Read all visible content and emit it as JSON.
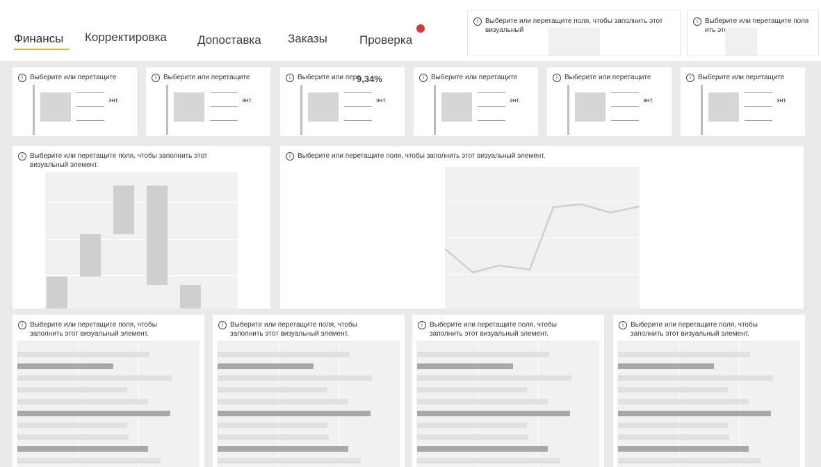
{
  "tabs": [
    "Финансы",
    "Корректировка",
    "Допоставка",
    "Заказы",
    "Проверка"
  ],
  "active_tab": 0,
  "colors": {
    "accent": "#e8b61b",
    "alert_dot": "#d33b35",
    "placeholder": "#d6d6d6",
    "card": "#ffffff"
  },
  "top_right_cards": [
    {
      "info_text": "Выберите или перетащите поля, чтобы заполнить этот визуальный",
      "icon": "info-icon"
    },
    {
      "info_text": "Выберите или перетащите поля ить этот визу т.",
      "icon": "info-icon"
    }
  ],
  "kpi_cards": [
    {
      "info_text": "Выберите или перетащите",
      "tail": "энт."
    },
    {
      "info_text": "Выберите или перетащите",
      "tail": "энт."
    },
    {
      "info_text": "Выберите или пере",
      "value": "9,34%",
      "tail": "энт."
    },
    {
      "info_text": "Выберите или перетащите",
      "tail": "энт."
    },
    {
      "info_text": "Выберите или перетащите",
      "tail": "энт."
    },
    {
      "info_text": "Выберите или перетащите",
      "tail": "энт."
    }
  ],
  "waterfall_card": {
    "info_text": "Выберите или перетащите поля, чтобы заполнить этот визуальный элемент."
  },
  "line_card": {
    "info_text": "Выберите или перетащите поля, чтобы заполнить этот визуальный элемент."
  },
  "bar_cards": [
    {
      "info_text": "Выберите или перетащите поля, чтобы заполнить этот визуальный элемент."
    },
    {
      "info_text": "Выберите или перетащите поля, чтобы заполнить этот визуальный элемент."
    },
    {
      "info_text": "Выберите или перетащите поля, чтобы заполнить этот визуальный элемент."
    },
    {
      "info_text": "Выберите или перетащите поля, чтобы заполнить этот визуальный элемент."
    }
  ]
}
